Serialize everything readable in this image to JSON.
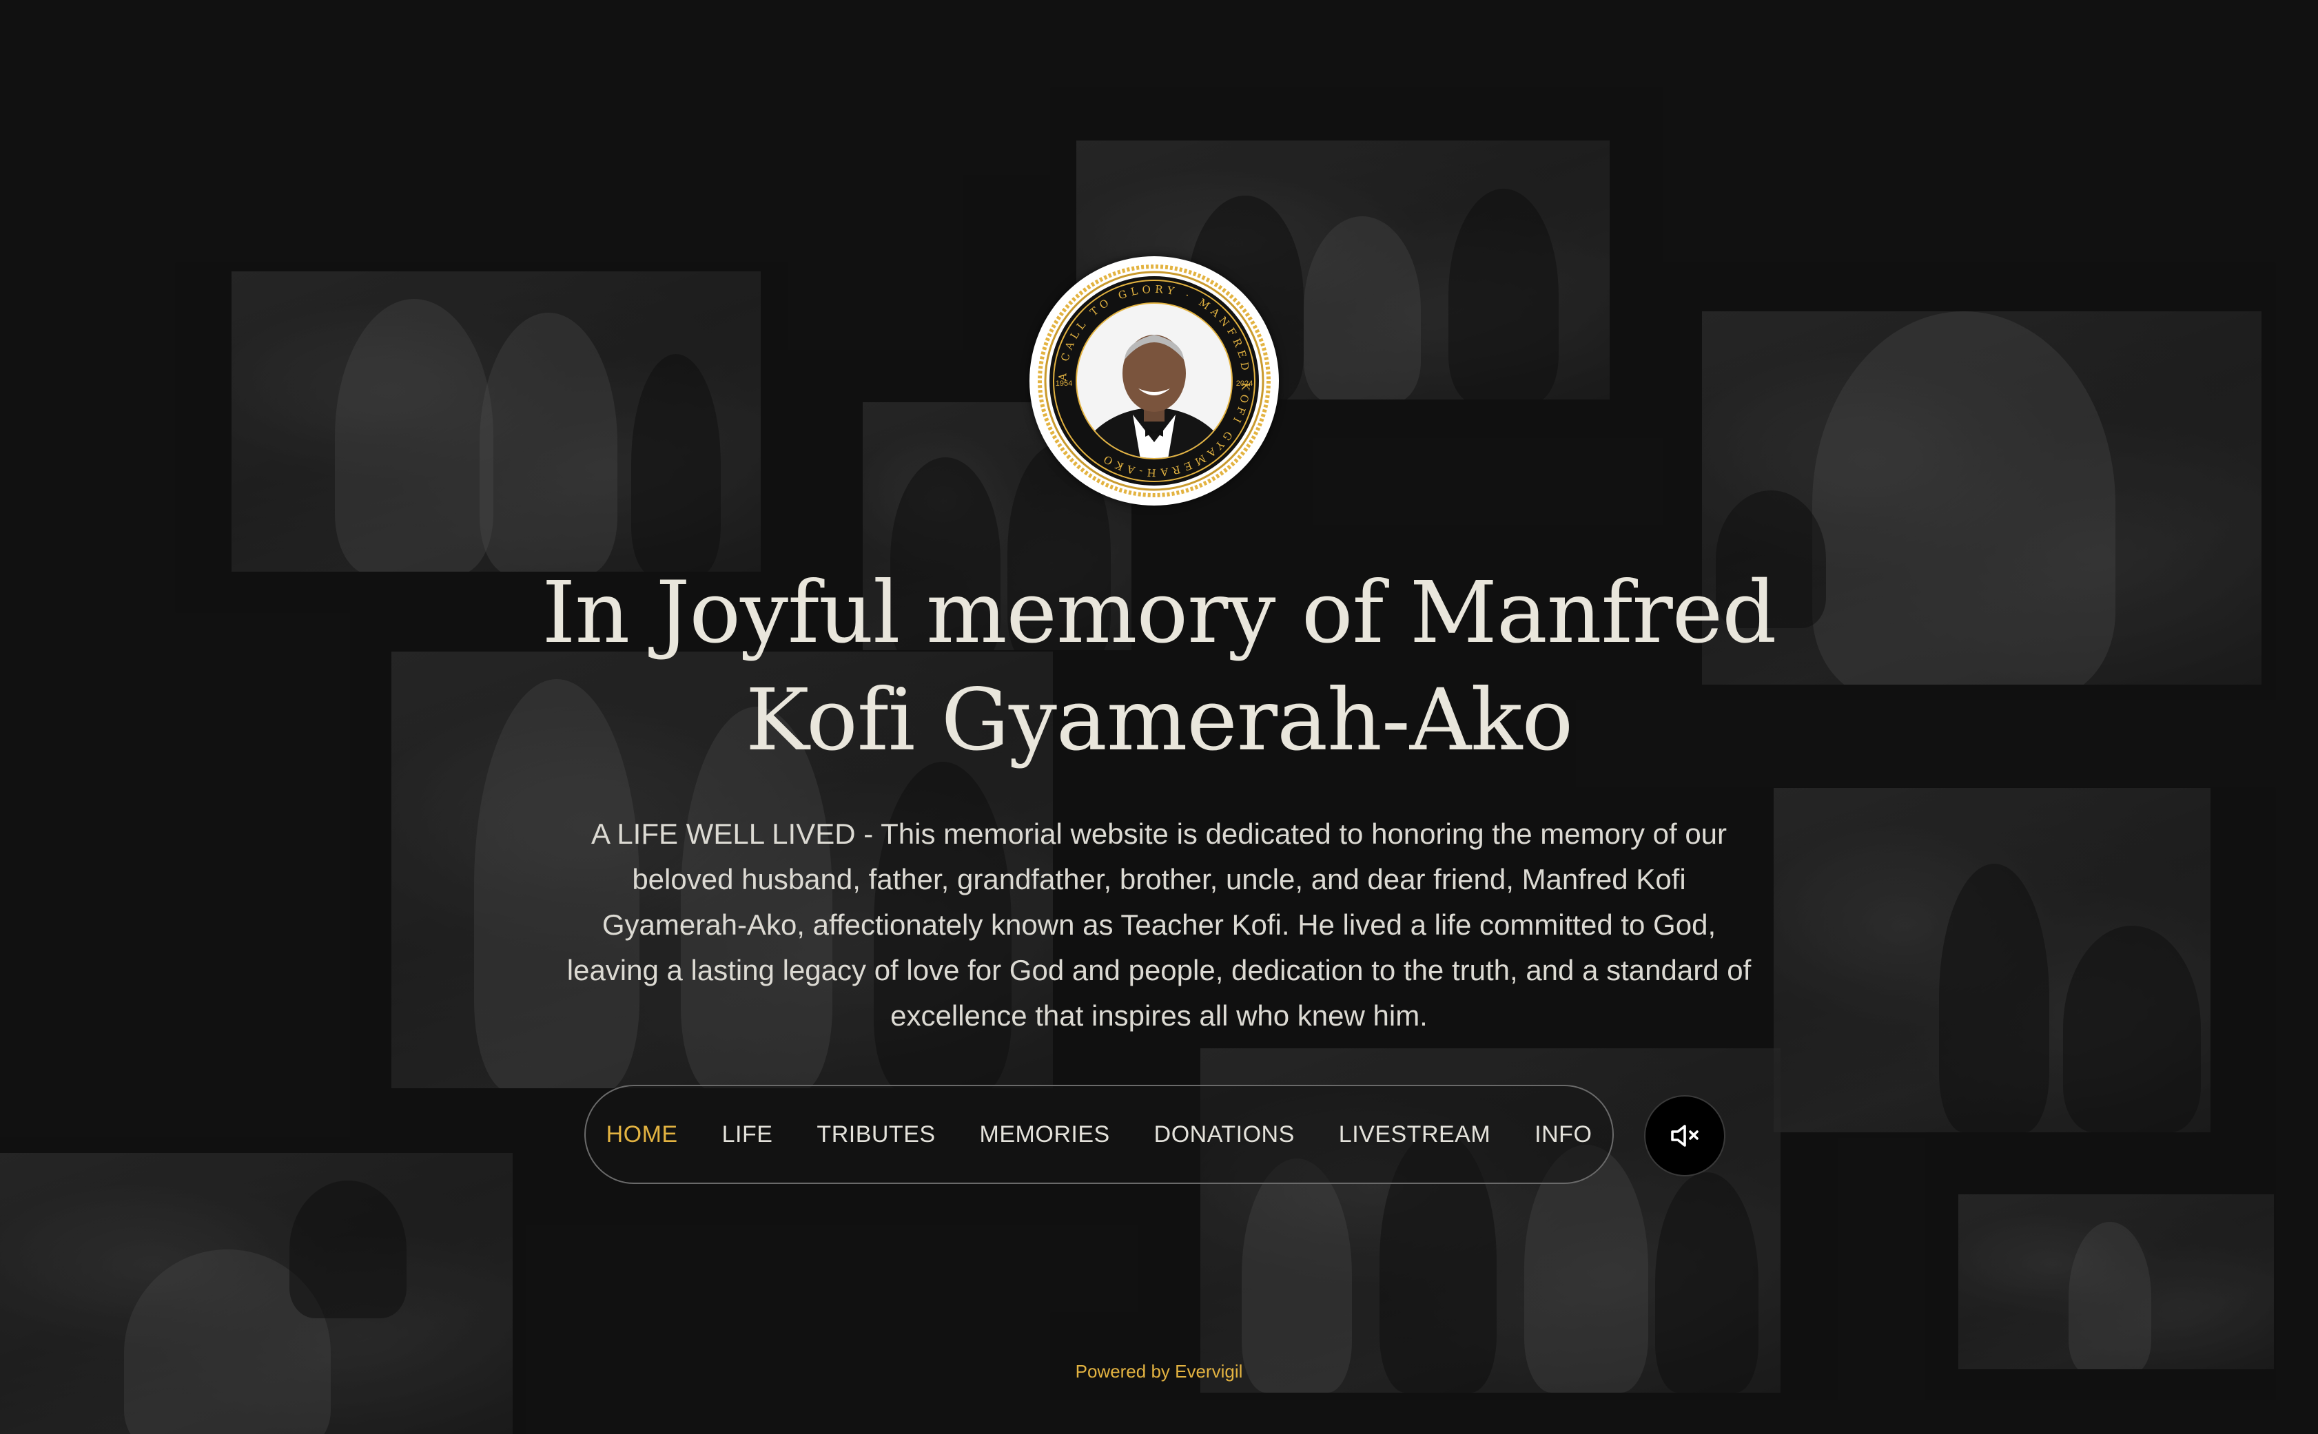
{
  "hero": {
    "title_line1": "In Joyful memory of Manfred",
    "title_line2": "Kofi Gyamerah-Ako",
    "intro_lines": [
      "A LIFE WELL LIVED - This memorial website is dedicated to honoring the memory of our",
      "beloved husband, father, grandfather, brother, uncle, and dear friend, Manfred Kofi",
      "Gyamerah-Ako, affectionately known as Teacher Kofi. He lived a life committed to God,",
      "leaving a lasting legacy of love for God and people, dedication to the truth, and a standard of",
      "excellence that inspires all who knew him."
    ]
  },
  "medallion": {
    "ring_text": "A CALL TO GLORY · MANFRED KOFI GYAMERAH-AKO",
    "year_left": "1954",
    "year_right": "2024"
  },
  "nav": {
    "items": [
      {
        "label": "HOME",
        "active": true
      },
      {
        "label": "LIFE",
        "active": false
      },
      {
        "label": "TRIBUTES",
        "active": false
      },
      {
        "label": "MEMORIES",
        "active": false
      },
      {
        "label": "DONATIONS",
        "active": false
      },
      {
        "label": "LIVESTREAM",
        "active": false
      },
      {
        "label": "INFO",
        "active": false
      }
    ],
    "mute_icon": "volume-muted-icon"
  },
  "footer": {
    "powered_by": "Powered by Evervigil"
  },
  "colors": {
    "background": "#111111",
    "accent_gold": "#e3b341",
    "text_light": "#e9e6dc"
  }
}
